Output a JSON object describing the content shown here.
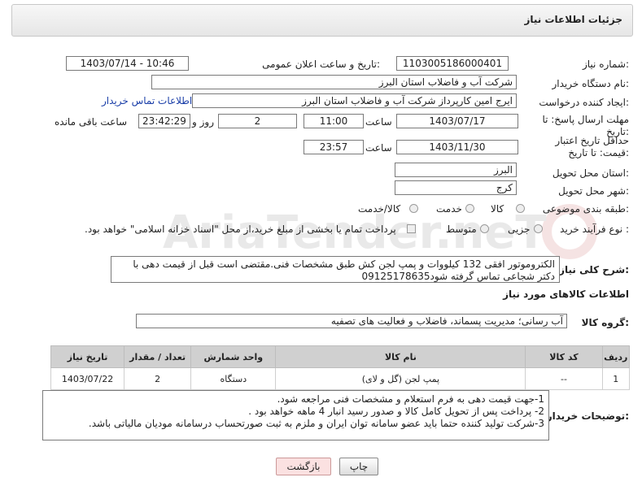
{
  "header": {
    "title": "جزئیات اطلاعات نیاز"
  },
  "form": {
    "need_number_label": "شماره نیاز:",
    "need_number": "1103005186000401",
    "announce_label": "تاریخ و ساعت اعلان عمومی:",
    "announce_value": "1403/07/14 - 10:46",
    "buyer_org_label": "نام دستگاه خریدار:",
    "buyer_org": "شرکت آب و فاضلاب استان البرز",
    "requester_label": "ایجاد کننده درخواست:",
    "requester": "ایرج امین کارپرداز شرکت آب و فاضلاب استان البرز",
    "contact_link": "اطلاعات تماس خریدار",
    "reply_deadline_label": "مهلت ارسال پاسخ: تا تاریخ:",
    "reply_date": "1403/07/17",
    "hour_label": "ساعت",
    "reply_time": "11:00",
    "days_value": "2",
    "days_label": "روز و",
    "remaining_time": "23:42:29",
    "remaining_label": "ساعت باقی مانده",
    "validity_label": "حداقل تاریخ اعتبار قیمت: تا تاریخ:",
    "validity_date": "1403/11/30",
    "validity_time": "23:57",
    "province_label": "استان محل تحویل:",
    "province": "البرز",
    "city_label": "شهر محل تحویل:",
    "city": "کرج",
    "category_label": "طبقه بندی موضوعی:",
    "category_options": [
      "کالا",
      "خدمت",
      "کالا/خدمت"
    ],
    "process_label": "نوع فرآیند خرید :",
    "process_options": [
      "جزیی",
      "متوسط"
    ],
    "payment_text": "پرداخت تمام یا بخشی از مبلغ خرید،از محل \"اسناد خزانه اسلامی\" خواهد بود."
  },
  "summary": {
    "label": "شرح کلی نیاز:",
    "text": "الکتروموتور افقی 132 کیلووات و پمپ لجن کش طبق مشخصات فنی.مقتضی است قبل از قیمت دهی با دکتر شجاعی تماس گرفته شود09125178635"
  },
  "goods": {
    "section_title": "اطلاعات کالاهای مورد نیاز",
    "group_label": "گروه کالا:",
    "group_value": "آب رسانی؛ مدیریت پسماند، فاضلاب و فعالیت های تصفیه",
    "columns": [
      "ردیف",
      "کد کالا",
      "نام کالا",
      "واحد شمارش",
      "تعداد / مقدار",
      "تاریخ نیاز"
    ],
    "rows": [
      {
        "row": "1",
        "code": "--",
        "name": "پمپ لجن (گل و لای)",
        "unit": "دستگاه",
        "qty": "2",
        "date": "1403/07/22"
      }
    ]
  },
  "buyer_notes": {
    "label": "توضیحات خریدار:",
    "lines": [
      "1-جهت قیمت دهی به فرم استعلام و مشخصات فنی مراجعه شود.",
      "2- پرداخت پس از تحویل کامل کالا و صدور رسید انبار 4 ماهه خواهد بود .",
      "3-شرکت تولید کننده حتما باید عضو سامانه توان ایران و ملزم به ثبت صورتحساب درسامانه مودیان مالیاتی باشد."
    ]
  },
  "buttons": {
    "print": "چاپ",
    "back": "بازگشت"
  },
  "watermark": {
    "text": "AriaTender.neT"
  }
}
